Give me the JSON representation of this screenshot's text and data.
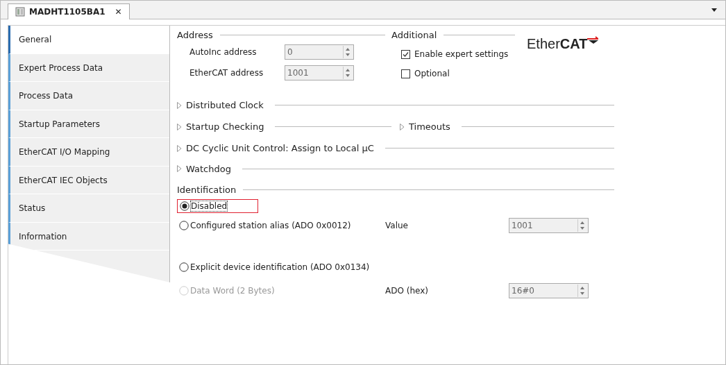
{
  "tab": {
    "title": "MADHT1105BA1",
    "close": "✕"
  },
  "nav": [
    {
      "label": "General",
      "selected": true
    },
    {
      "label": "Expert Process Data",
      "selected": false
    },
    {
      "label": "Process Data",
      "selected": false
    },
    {
      "label": "Startup Parameters",
      "selected": false
    },
    {
      "label": "EtherCAT I/O Mapping",
      "selected": false
    },
    {
      "label": "EtherCAT IEC Objects",
      "selected": false
    },
    {
      "label": "Status",
      "selected": false
    },
    {
      "label": "Information",
      "selected": false
    }
  ],
  "address": {
    "title": "Address",
    "fields": [
      {
        "label": "AutoInc address",
        "value": "0"
      },
      {
        "label": "EtherCAT address",
        "value": "1001"
      }
    ]
  },
  "additional": {
    "title": "Additional",
    "options": [
      {
        "label": "Enable expert settings",
        "checked": true
      },
      {
        "label": "Optional",
        "checked": false
      }
    ]
  },
  "logo": "Ether**CAT**",
  "sections": [
    [
      {
        "title": "Distributed Clock",
        "expanded": false
      }
    ],
    [
      {
        "title": "Startup Checking",
        "expanded": false
      },
      {
        "title": "Timeouts",
        "expanded": false
      }
    ],
    [
      {
        "title": "DC Cyclic Unit Control: Assign to Local µC",
        "expanded": false
      }
    ],
    [
      {
        "title": "Watchdog",
        "expanded": false
      }
    ]
  ],
  "identification": {
    "title": "Identification",
    "options": [
      {
        "label": "Disabled",
        "selected": true,
        "disabled": false,
        "highlighted": true
      },
      {
        "label": "Configured station alias (ADO 0x0012)",
        "selected": false,
        "disabled": false,
        "highlighted": false,
        "field": {
          "label": "Value",
          "value": "1001"
        }
      },
      {
        "label": "Explicit device identification (ADO 0x0134)",
        "selected": false,
        "disabled": false,
        "highlighted": false
      },
      {
        "label": "Data Word (2 Bytes)",
        "selected": false,
        "disabled": true,
        "highlighted": false,
        "field": {
          "label": "ADO (hex)",
          "value": "16#0"
        }
      }
    ]
  }
}
